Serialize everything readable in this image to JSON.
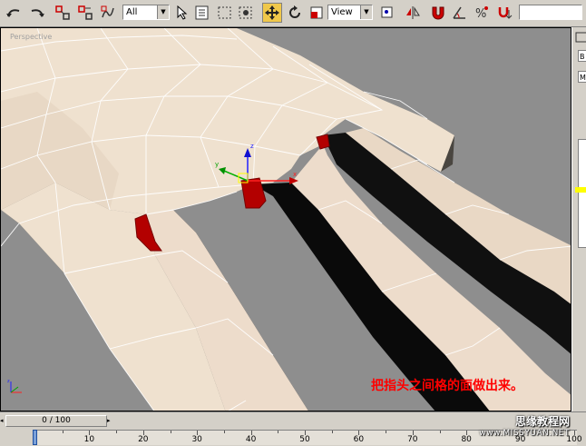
{
  "toolbar": {
    "selection_filter": "All",
    "reference_coord": "View"
  },
  "viewport": {
    "label": "Perspective",
    "annotation": "把指头之间格的面做出来。"
  },
  "command_panel": {
    "field1": "B",
    "field2": "M"
  },
  "timeline": {
    "slider_label": "0 / 100",
    "ticks": [
      "10",
      "20",
      "30",
      "40",
      "50",
      "60",
      "70",
      "80",
      "90",
      "100"
    ]
  },
  "watermark": {
    "title": "思缘教程网",
    "url": "www.MISSYUAN.NET"
  },
  "icons": [
    "undo-icon",
    "redo-icon",
    "link-icon",
    "unlink-icon",
    "bind-space-warp-icon",
    "select-object-icon",
    "select-by-name-icon",
    "rectangular-selection-icon",
    "window-crossing-icon",
    "move-icon",
    "rotate-icon",
    "scale-icon",
    "pivot-icon",
    "mirror-icon",
    "snap-icon",
    "angle-snap-icon",
    "percent-snap-icon",
    "spinner-snap-icon"
  ],
  "colors": {
    "skin": "#efe1cf",
    "viewport_bg": "#8e8e8e",
    "face_selected": "#b30000",
    "annotation": "#ff0000"
  }
}
